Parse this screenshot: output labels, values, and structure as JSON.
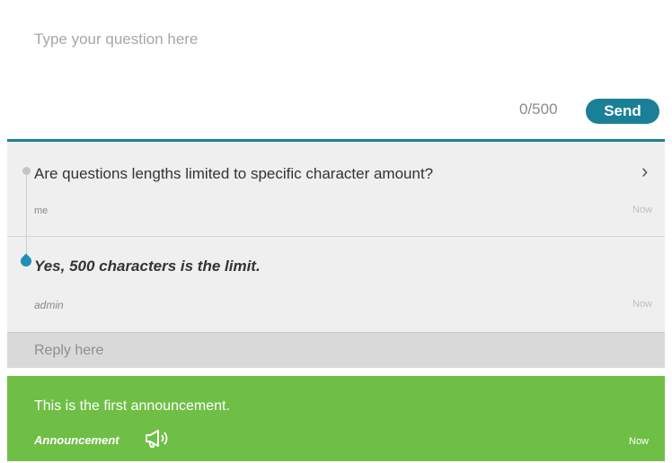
{
  "composer": {
    "placeholder": "Type your question here",
    "char_count": "0/500",
    "send_label": "Send"
  },
  "thread": {
    "question": {
      "text": "Are questions lengths limited to specific character amount?",
      "author": "me",
      "time": "Now"
    },
    "answer": {
      "text": "Yes, 500 characters is the limit.",
      "author": "admin",
      "time": "Now"
    },
    "reply_placeholder": "Reply here"
  },
  "announcement": {
    "text": "This is the first announcement.",
    "label": "Announcement",
    "time": "Now",
    "icon": "megaphone-icon"
  },
  "colors": {
    "accent": "#1a8096",
    "announcement_bg": "#6fbf46",
    "thread_bg": "#efefef",
    "reply_bg": "#d9d9d9",
    "answer_marker": "#1f8fb6"
  }
}
